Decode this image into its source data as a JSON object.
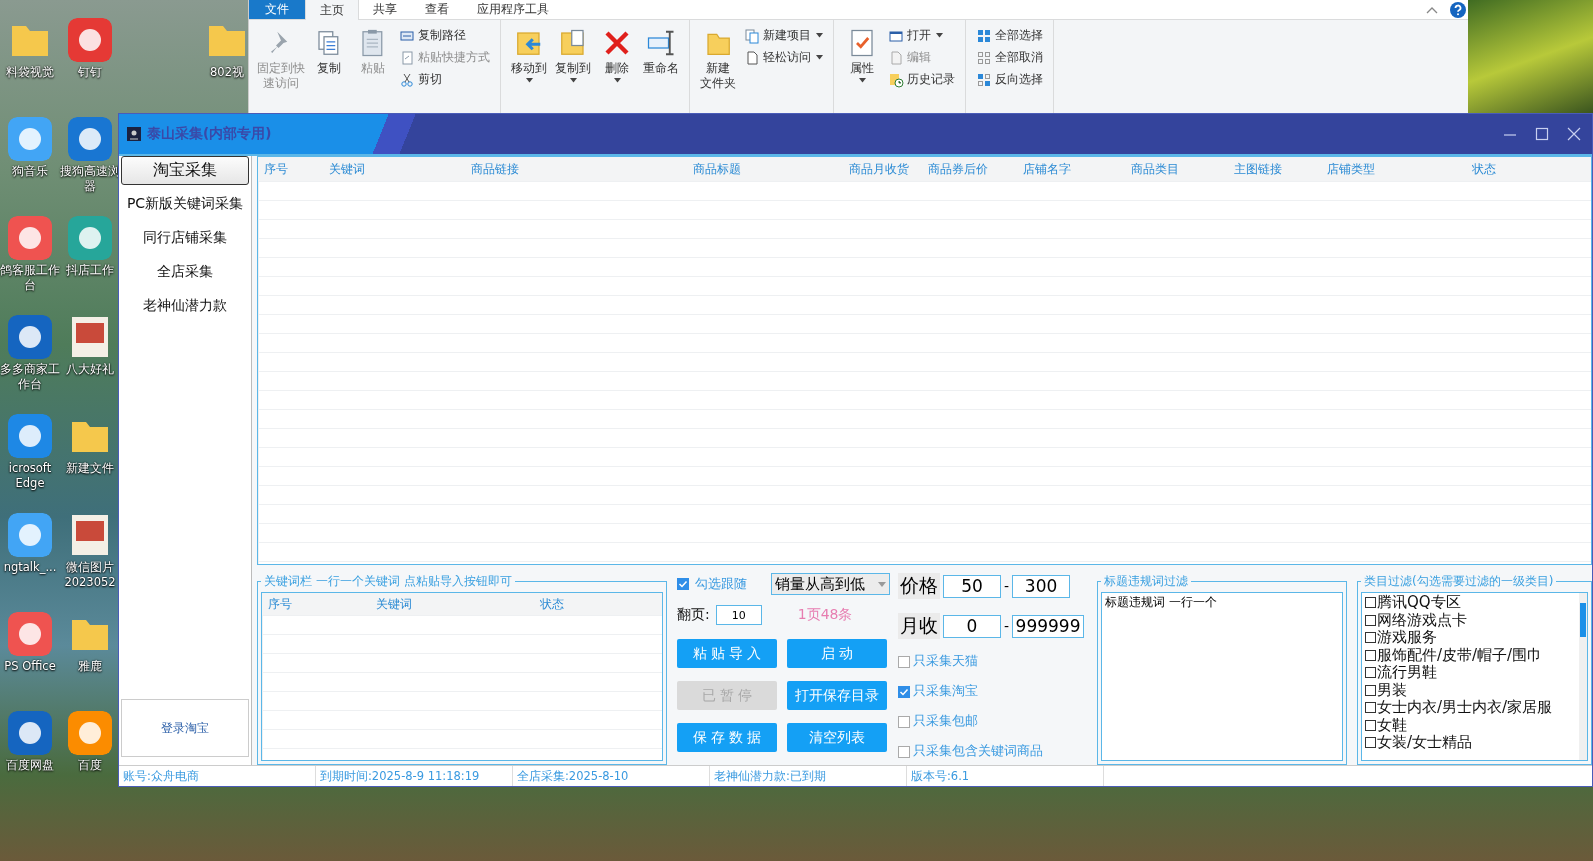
{
  "desktop_icons": [
    {
      "kind": "folder",
      "lines": [
        "料袋视觉"
      ]
    },
    {
      "kind": "app",
      "lines": [
        "钉钉"
      ]
    },
    {
      "kind": "app",
      "lines": [
        "狗音乐"
      ]
    },
    {
      "kind": "app",
      "lines": [
        "搜狗高速浏",
        "器"
      ]
    },
    {
      "kind": "app",
      "lines": [
        "鸽客服工作",
        "台"
      ]
    },
    {
      "kind": "app",
      "lines": [
        "抖店工作"
      ]
    },
    {
      "kind": "app",
      "lines": [
        "多多商家工",
        "作台"
      ]
    },
    {
      "kind": "photo",
      "lines": [
        "八大好礼"
      ]
    },
    {
      "kind": "app",
      "lines": [
        "icrosoft",
        "Edge"
      ]
    },
    {
      "kind": "folder",
      "lines": [
        "新建文件"
      ]
    },
    {
      "kind": "app",
      "lines": [
        "ngtalk_..."
      ]
    },
    {
      "kind": "photo",
      "lines": [
        "微信图片",
        "2023052"
      ]
    },
    {
      "kind": "app",
      "lines": [
        "PS Office"
      ]
    },
    {
      "kind": "folder",
      "lines": [
        "雅鹿"
      ]
    },
    {
      "kind": "app",
      "lines": [
        "百度网盘"
      ]
    },
    {
      "kind": "app",
      "lines": [
        "百度"
      ]
    }
  ],
  "desktop_icon_top_right": {
    "lines": [
      "802视"
    ]
  },
  "explorer": {
    "tabs": [
      {
        "label": "文件",
        "selected": false,
        "kind": "file"
      },
      {
        "label": "主页",
        "selected": true,
        "kind": "tab"
      },
      {
        "label": "共享",
        "selected": false,
        "kind": "tab"
      },
      {
        "label": "查看",
        "selected": false,
        "kind": "tab"
      },
      {
        "label": "应用程序工具",
        "selected": false,
        "kind": "tab"
      }
    ],
    "groups": [
      {
        "items": [
          {
            "lines": [
              "固定到快",
              "速访问"
            ],
            "kind": "large",
            "disabled": true,
            "dropdown": false
          },
          {
            "lines": [
              "复制"
            ],
            "kind": "large",
            "disabled": false,
            "dropdown": false
          },
          {
            "lines": [
              "粘贴"
            ],
            "kind": "large",
            "disabled": true,
            "dropdown": false
          },
          {
            "label": "复制路径",
            "kind": "small",
            "disabled": false,
            "dropdown": false
          },
          {
            "label": "粘贴快捷方式",
            "kind": "small",
            "disabled": true,
            "dropdown": false
          },
          {
            "label": "剪切",
            "kind": "small",
            "disabled": false,
            "dropdown": false
          }
        ]
      },
      {
        "items": [
          {
            "lines": [
              "移动到"
            ],
            "kind": "large",
            "disabled": false,
            "dropdown": true
          },
          {
            "lines": [
              "复制到"
            ],
            "kind": "large",
            "disabled": false,
            "dropdown": true
          },
          {
            "lines": [
              "删除"
            ],
            "kind": "large",
            "disabled": false,
            "dropdown": true
          },
          {
            "lines": [
              "重命名"
            ],
            "kind": "large",
            "disabled": false,
            "dropdown": false
          }
        ]
      },
      {
        "items": [
          {
            "lines": [
              "新建",
              "文件夹"
            ],
            "kind": "large",
            "disabled": false,
            "dropdown": false
          },
          {
            "label": "新建项目",
            "kind": "small",
            "disabled": false,
            "dropdown": true
          },
          {
            "label": "轻松访问",
            "kind": "small",
            "disabled": false,
            "dropdown": true
          }
        ]
      },
      {
        "items": [
          {
            "lines": [
              "属性"
            ],
            "kind": "large",
            "disabled": false,
            "dropdown": true
          },
          {
            "label": "打开",
            "kind": "small",
            "disabled": false,
            "dropdown": true
          },
          {
            "label": "编辑",
            "kind": "small",
            "disabled": true,
            "dropdown": false
          },
          {
            "label": "历史记录",
            "kind": "small",
            "disabled": false,
            "dropdown": false
          }
        ]
      },
      {
        "items": [
          {
            "label": "全部选择",
            "kind": "small",
            "disabled": false,
            "dropdown": false
          },
          {
            "label": "全部取消",
            "kind": "small",
            "disabled": false,
            "dropdown": false
          },
          {
            "label": "反向选择",
            "kind": "small",
            "disabled": false,
            "dropdown": false
          }
        ]
      }
    ]
  },
  "window": {
    "title": "泰山采集(内部专用)"
  },
  "sidebar": {
    "items": [
      {
        "label": "淘宝采集",
        "selected": true
      },
      {
        "label": "PC新版关键词采集",
        "selected": false
      },
      {
        "label": "同行店铺采集",
        "selected": false
      },
      {
        "label": "全店采集",
        "selected": false
      },
      {
        "label": "老神仙潜力款",
        "selected": false
      }
    ],
    "login_button": "登录淘宝"
  },
  "table": {
    "columns": [
      "序号",
      "关键词",
      "商品链接",
      "商品标题",
      "商品月收货",
      "商品券后价",
      "店铺名字",
      "商品类目",
      "主图链接",
      "店铺类型",
      "状态"
    ]
  },
  "keyword_panel": {
    "legend": "关键词栏 一行一个关键词 点粘贴导入按钮即可",
    "columns": [
      "序号",
      "关键词",
      "状态"
    ]
  },
  "controls": {
    "follow_checkbox": {
      "label": "勾选跟随",
      "checked": true
    },
    "sort_select": "销量从高到低",
    "price_label": "价格",
    "price_min": "50",
    "price_max": "300",
    "range_dash": "-",
    "page_label": "翻页:",
    "pages": "10",
    "page_info": "1页48条",
    "monthly_label": "月收",
    "monthly_min": "0",
    "monthly_max": "999999",
    "buttons": [
      {
        "label": "粘 贴 导 入",
        "disabled": false
      },
      {
        "label": "启 动",
        "disabled": false
      },
      {
        "label": "已 暂 停",
        "disabled": true
      },
      {
        "label": "打开保存目录",
        "disabled": false
      },
      {
        "label": "保 存 数 据",
        "disabled": false
      },
      {
        "label": "清空列表",
        "disabled": false
      }
    ],
    "filters": [
      {
        "label": "只采集天猫",
        "checked": false
      },
      {
        "label": "只采集淘宝",
        "checked": true
      },
      {
        "label": "只采集包邮",
        "checked": false
      },
      {
        "label": "只采集包含关键词商品",
        "checked": false
      }
    ]
  },
  "title_filter": {
    "legend": "标题违规词过滤",
    "value": "标题违规词 一行一个"
  },
  "category_filter": {
    "legend": "类目过滤(勾选需要过滤的一级类目)",
    "items": [
      {
        "label": "腾讯QQ专区",
        "checked": false
      },
      {
        "label": "网络游戏点卡",
        "checked": false
      },
      {
        "label": "游戏服务",
        "checked": false
      },
      {
        "label": "服饰配件/皮带/帽子/围巾",
        "checked": false
      },
      {
        "label": "流行男鞋",
        "checked": false
      },
      {
        "label": "男装",
        "checked": false
      },
      {
        "label": "女士内衣/男士内衣/家居服",
        "checked": false
      },
      {
        "label": "女鞋",
        "checked": false
      },
      {
        "label": "女装/女士精品",
        "checked": false
      }
    ]
  },
  "status_bar": [
    "账号:众舟电商",
    "到期时间:2025-8-9 11:18:19",
    "全店采集:2025-8-10",
    "老神仙潜力款:已到期",
    "版本号:6.1"
  ]
}
